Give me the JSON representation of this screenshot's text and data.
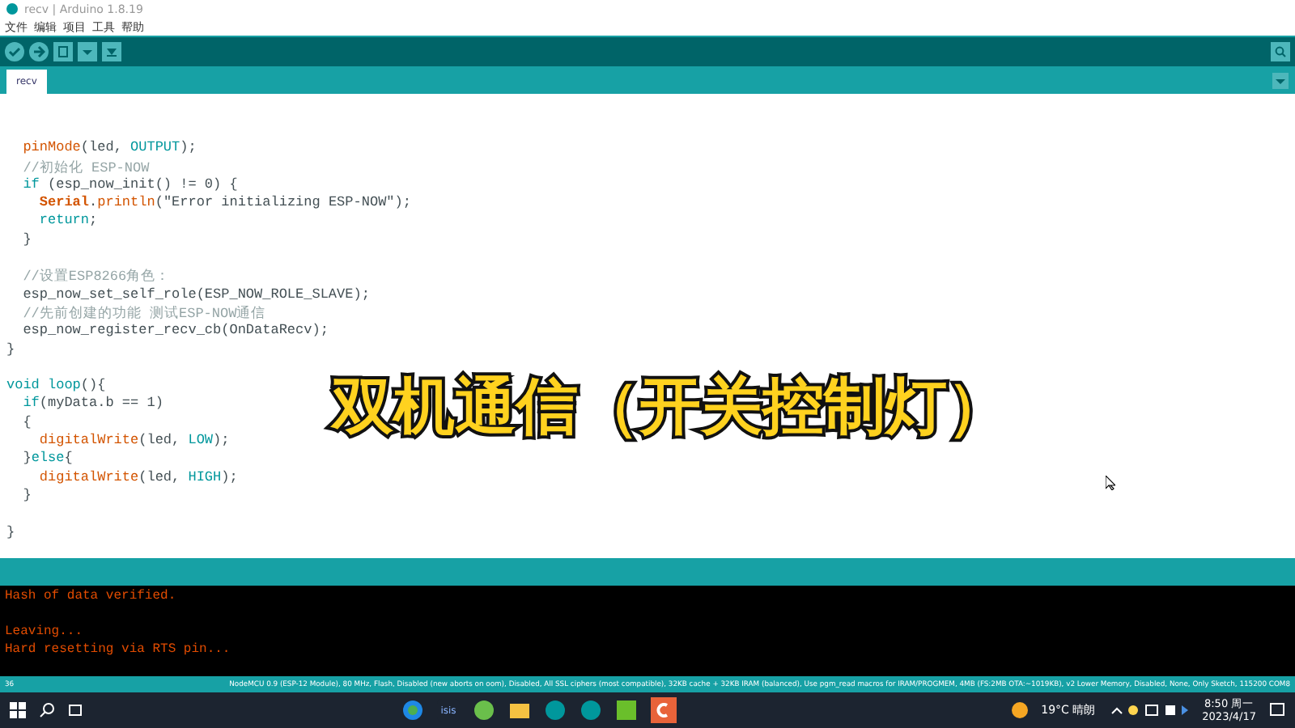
{
  "window": {
    "title": "recv | Arduino 1.8.19"
  },
  "menu": [
    "文件",
    "编辑",
    "项目",
    "工具",
    "帮助"
  ],
  "tabs": [
    {
      "label": "recv",
      "selected": true
    }
  ],
  "code": [
    {
      "kind": "blank"
    },
    {
      "segments": [
        {
          "kind": "function",
          "text": "  pinMode"
        },
        {
          "kind": "plain",
          "text": "(led, "
        },
        {
          "kind": "constant",
          "text": "OUTPUT"
        },
        {
          "kind": "plain",
          "text": ");"
        }
      ]
    },
    {
      "segments": [
        {
          "kind": "comment",
          "text": "  //初始化 ESP-NOW"
        }
      ]
    },
    {
      "segments": [
        {
          "kind": "keyword",
          "text": "  if"
        },
        {
          "kind": "plain",
          "text": " (esp_now_init() != 0) {"
        }
      ]
    },
    {
      "segments": [
        {
          "kind": "class",
          "text": "    Serial"
        },
        {
          "kind": "plain",
          "text": "."
        },
        {
          "kind": "function",
          "text": "println"
        },
        {
          "kind": "plain",
          "text": "(\"Error initializing ESP-NOW\");"
        }
      ]
    },
    {
      "segments": [
        {
          "kind": "keyword",
          "text": "    return"
        },
        {
          "kind": "plain",
          "text": ";"
        }
      ]
    },
    {
      "segments": [
        {
          "kind": "plain",
          "text": "  }"
        }
      ]
    },
    {
      "kind": "blank"
    },
    {
      "segments": [
        {
          "kind": "comment",
          "text": "  //设置ESP8266角色："
        }
      ]
    },
    {
      "segments": [
        {
          "kind": "plain",
          "text": "  esp_now_set_self_role(ESP_NOW_ROLE_SLAVE);"
        }
      ]
    },
    {
      "segments": [
        {
          "kind": "comment",
          "text": "  //先前创建的功能 测试ESP-NOW通信"
        }
      ]
    },
    {
      "segments": [
        {
          "kind": "plain",
          "text": "  esp_now_register_recv_cb(OnDataRecv);"
        }
      ]
    },
    {
      "segments": [
        {
          "kind": "plain",
          "text": "}"
        }
      ]
    },
    {
      "kind": "blank"
    },
    {
      "segments": [
        {
          "kind": "keyword",
          "text": "void loop"
        },
        {
          "kind": "plain",
          "text": "(){"
        }
      ]
    },
    {
      "segments": [
        {
          "kind": "keyword",
          "text": "  if"
        },
        {
          "kind": "plain",
          "text": "(myData.b == 1)"
        }
      ]
    },
    {
      "segments": [
        {
          "kind": "plain",
          "text": "  {"
        }
      ]
    },
    {
      "segments": [
        {
          "kind": "function",
          "text": "    digitalWrite"
        },
        {
          "kind": "plain",
          "text": "(led, "
        },
        {
          "kind": "constant",
          "text": "LOW"
        },
        {
          "kind": "plain",
          "text": ");"
        }
      ]
    },
    {
      "segments": [
        {
          "kind": "plain",
          "text": "  }"
        },
        {
          "kind": "keyword",
          "text": "else"
        },
        {
          "kind": "plain",
          "text": "{"
        }
      ]
    },
    {
      "segments": [
        {
          "kind": "function",
          "text": "    digitalWrite"
        },
        {
          "kind": "plain",
          "text": "(led, "
        },
        {
          "kind": "constant",
          "text": "HIGH"
        },
        {
          "kind": "plain",
          "text": ");"
        }
      ]
    },
    {
      "segments": [
        {
          "kind": "plain",
          "text": "  }"
        }
      ]
    },
    {
      "kind": "blank"
    },
    {
      "segments": [
        {
          "kind": "plain",
          "text": "}"
        }
      ]
    }
  ],
  "caption": "双机通信（开关控制灯）",
  "console": [
    {
      "text": "Hash of data verified."
    },
    {
      "kind": "blank"
    },
    {
      "text": "Leaving..."
    },
    {
      "text": "Hard resetting via RTS pin..."
    }
  ],
  "status_bar": {
    "line": "36",
    "board": "NodeMCU 0.9 (ESP-12 Module), 80 MHz, Flash, Disabled (new aborts on oom), Disabled, All SSL ciphers (most compatible), 32KB cache + 32KB IRAM (balanced), Use pgm_read macros for IRAM/PROGMEM, 4MB (FS:2MB OTA:~1019KB), v2 Lower Memory, Disabled, None, Only Sketch, 115200 COM8"
  },
  "taskbar": {
    "app_label": "isis",
    "weather": "19°C 晴朗",
    "time": "8:50 周一",
    "date": "2023/4/17"
  }
}
